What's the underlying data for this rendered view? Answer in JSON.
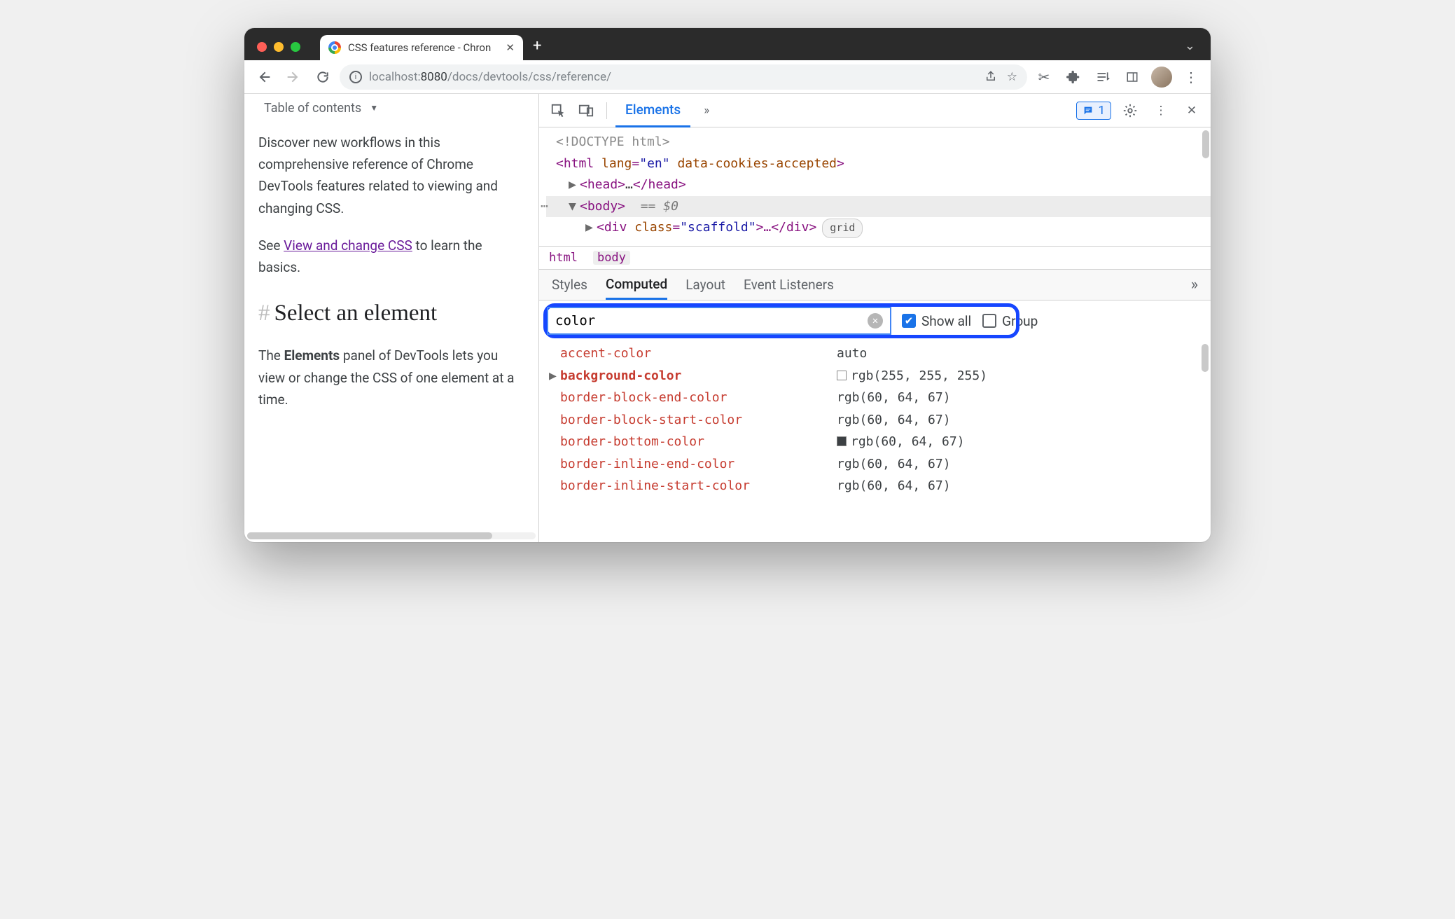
{
  "browser": {
    "tab_title": "CSS features reference - Chron",
    "url_host": "localhost:",
    "url_port": "8080",
    "url_path": "/docs/devtools/css/reference/"
  },
  "page": {
    "toc": "Table of contents",
    "p1": "Discover new workflows in this comprehensive reference of Chrome DevTools features related to viewing and changing CSS.",
    "p2a": "See ",
    "p2link": "View and change CSS",
    "p2b": " to learn the basics.",
    "h2": "Select an element",
    "p3a": "The ",
    "p3b": "Elements",
    "p3c": " panel of DevTools lets you view or change the CSS of one element at a time."
  },
  "devtools": {
    "tabs": {
      "elements": "Elements"
    },
    "issues_count": "1",
    "dom": {
      "doctype": "<!DOCTYPE html>",
      "html_open": "<html ",
      "html_attr1": "lang",
      "html_val1": "\"en\"",
      "html_attr2": "data-cookies-accepted",
      "html_close": ">",
      "head": "<head>…</head>",
      "body": "<body>",
      "eq": "== $0",
      "div_open": "<div ",
      "div_attr": "class",
      "div_val": "\"scaffold\"",
      "div_rest": ">…</div>",
      "badge": "grid"
    },
    "breadcrumb": {
      "a": "html",
      "b": "body"
    },
    "subtabs": {
      "styles": "Styles",
      "computed": "Computed",
      "layout": "Layout",
      "events": "Event Listeners"
    },
    "filter": {
      "value": "color",
      "showall": "Show all",
      "group": "Group"
    },
    "computed": [
      {
        "name": "accent-color",
        "value": "auto",
        "swatch": "",
        "exp": false,
        "bold": false
      },
      {
        "name": "background-color",
        "value": "rgb(255, 255, 255)",
        "swatch": "#ffffff",
        "exp": true,
        "bold": true
      },
      {
        "name": "border-block-end-color",
        "value": "rgb(60, 64, 67)",
        "swatch": "",
        "exp": false,
        "bold": false
      },
      {
        "name": "border-block-start-color",
        "value": "rgb(60, 64, 67)",
        "swatch": "",
        "exp": false,
        "bold": false
      },
      {
        "name": "border-bottom-color",
        "value": "rgb(60, 64, 67)",
        "swatch": "#3c4043",
        "exp": false,
        "bold": false
      },
      {
        "name": "border-inline-end-color",
        "value": "rgb(60, 64, 67)",
        "swatch": "",
        "exp": false,
        "bold": false
      },
      {
        "name": "border-inline-start-color",
        "value": "rgb(60, 64, 67)",
        "swatch": "",
        "exp": false,
        "bold": false
      }
    ]
  }
}
